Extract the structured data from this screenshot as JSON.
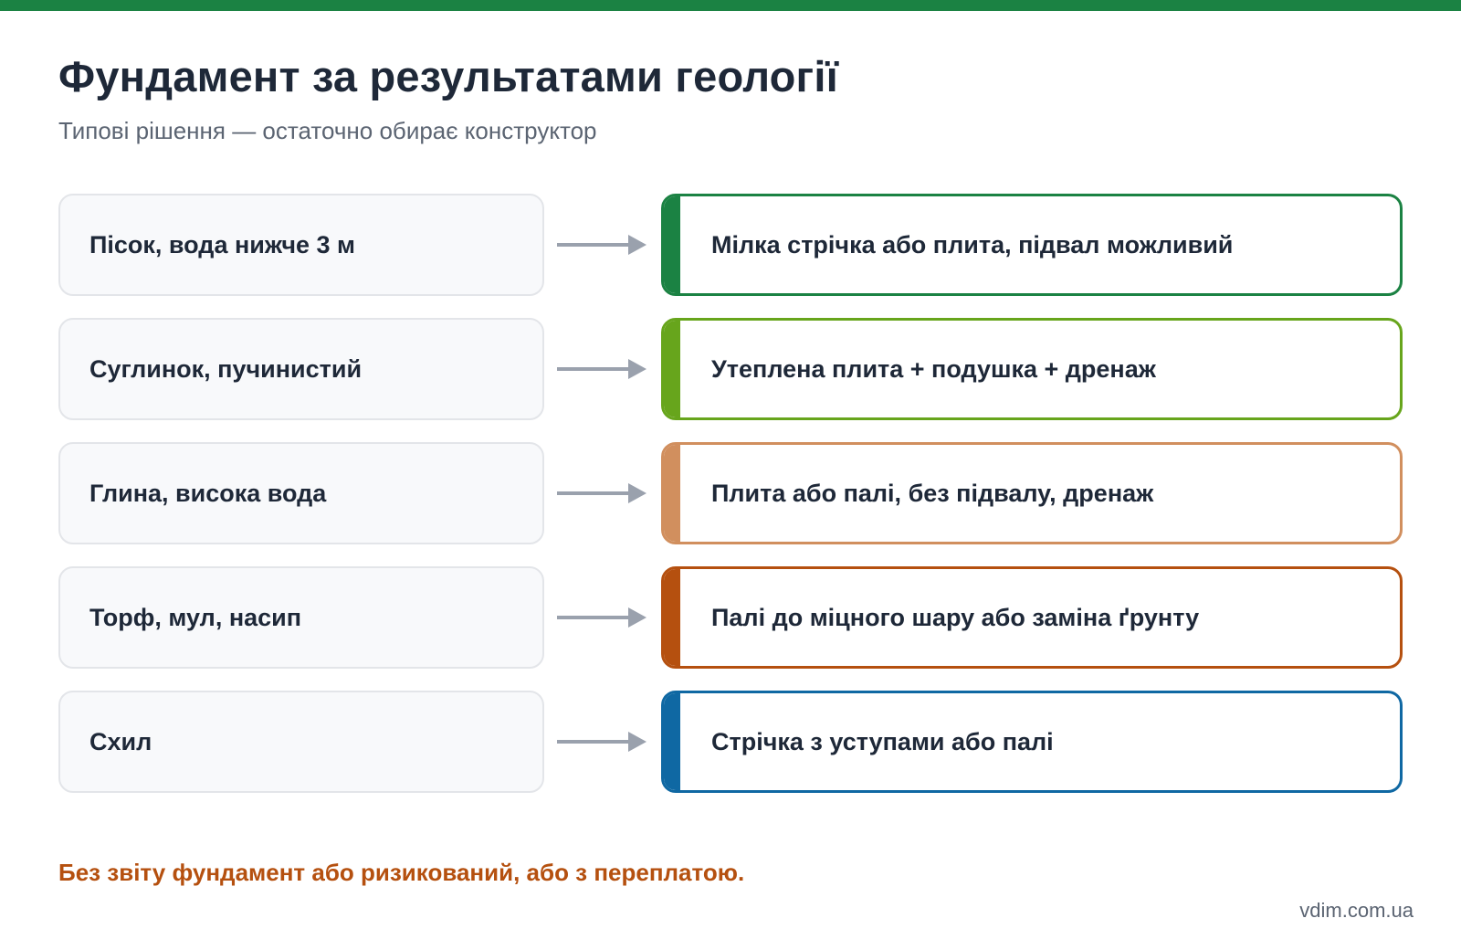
{
  "header": {
    "accent_color": "#1b8243",
    "title": "Фундамент за результатами геології",
    "subtitle": "Типові рішення — остаточно обирає конструктор"
  },
  "rows": [
    {
      "soil": "Пісок, вода нижче 3 м",
      "solution": "Мілка стрічка або плита, підвал можливий",
      "color": "#1b8243"
    },
    {
      "soil": "Суглинок, пучинистий",
      "solution": "Утеплена плита + подушка + дренаж",
      "color": "#67a51c"
    },
    {
      "soil": "Глина, висока вода",
      "solution": "Плита або палі, без підвалу, дренаж",
      "color": "#d18f5e"
    },
    {
      "soil": "Торф, мул, насип",
      "solution": "Палі до міцного шару або заміна ґрунту",
      "color": "#b5500f"
    },
    {
      "soil": "Схил",
      "solution": "Стрічка з уступами або палі",
      "color": "#0f68a3"
    }
  ],
  "arrow_color": "#9aa1ad",
  "note": "Без звіту фундамент або ризикований, або з переплатою.",
  "footer": {
    "site": "vdim.com.ua"
  }
}
